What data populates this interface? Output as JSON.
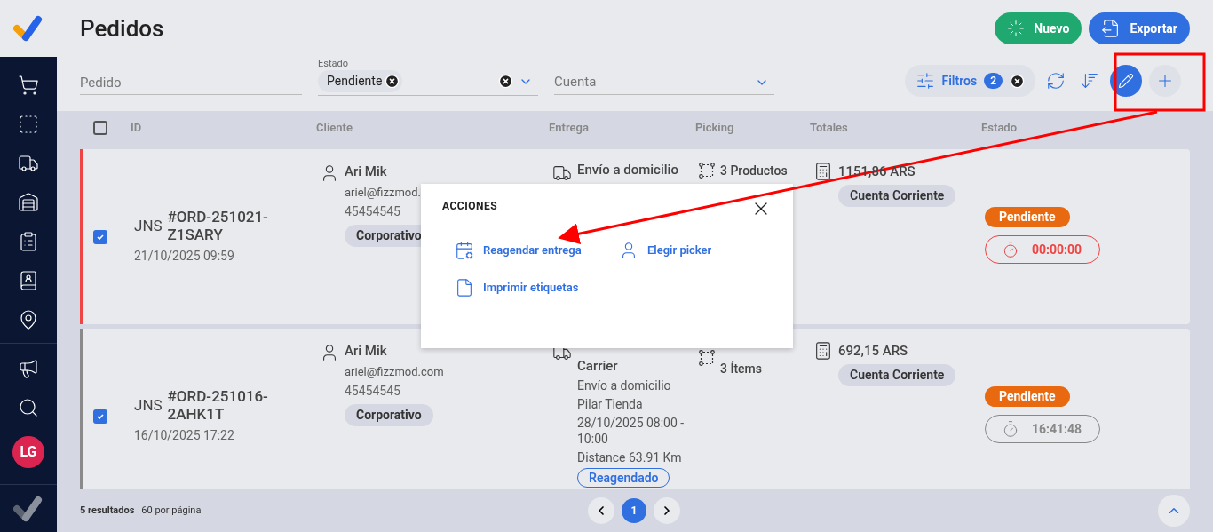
{
  "sidebar": {
    "avatar": "LG"
  },
  "page": {
    "title": "Pedidos"
  },
  "header_buttons": [
    {
      "kind": "new",
      "label": "Nuevo"
    },
    {
      "kind": "export",
      "label": "Exportar"
    }
  ],
  "filters": {
    "pedido": {
      "placeholder": "Pedido"
    },
    "estado": {
      "label": "Estado",
      "chips": [
        "Pendiente"
      ]
    },
    "cuenta": {
      "placeholder": "Cuenta"
    }
  },
  "toolbar": {
    "filters_label": "Filtros",
    "filters_count": "2",
    "edit_selected": true
  },
  "table": {
    "select_all_checked": false,
    "columns": [
      "ID",
      "Cliente",
      "Entrega",
      "Picking",
      "Totales",
      "Estado"
    ],
    "rows": [
      {
        "color": "#ef4444",
        "checked": true,
        "store": "JNS",
        "order_id": "#ORD-251021-Z1SARY",
        "date": "21/10/2025 09:59",
        "top_line_covered": false,
        "client": "Ari Mik",
        "email": "ariel@fizzmod.",
        "phone": "45454545",
        "segment": "Corporativo",
        "delivery_title": "Envío a domicilio",
        "delivery_lines": [],
        "picking": [
          "3 Productos"
        ],
        "total": "1151,86 ARS",
        "payment": "Cuenta Corriente",
        "status": "Pendiente",
        "timer": "00:00:00",
        "timer_alert": true
      },
      {
        "color": "#8a8a8a",
        "checked": true,
        "store": "JNS",
        "order_id": "#ORD-251016-2AHK1T",
        "date": "16/10/2025 17:22",
        "client": "Ari Mik",
        "email": "ariel@fizzmod.com",
        "phone": "45454545",
        "segment": "Corporativo",
        "top_line_covered": true,
        "delivery_title": "Carrier",
        "delivery_lines": [
          "Envío a domicilio",
          "Pilar Tienda",
          "28/10/2025 08:00 - 10:00",
          "Distance 63.91 Km"
        ],
        "delivery_badge": "Reagendado",
        "picking": [
          "3 Ítems"
        ],
        "total": "692,15 ARS",
        "payment": "Cuenta Corriente",
        "status": "Pendiente",
        "timer": "16:41:48",
        "timer_alert": false
      }
    ]
  },
  "actions_popup": {
    "title": "ACCIONES",
    "items": [
      {
        "kind": "reschedule",
        "label": "Reagendar entrega"
      },
      {
        "kind": "picker",
        "label": "Elegir picker"
      },
      {
        "kind": "labels",
        "label": "Imprimir etiquetas"
      }
    ]
  },
  "footer": {
    "results": "5 resultados",
    "per_page": "60 por página",
    "pages": [
      {
        "label": "1",
        "selected": true
      }
    ]
  }
}
